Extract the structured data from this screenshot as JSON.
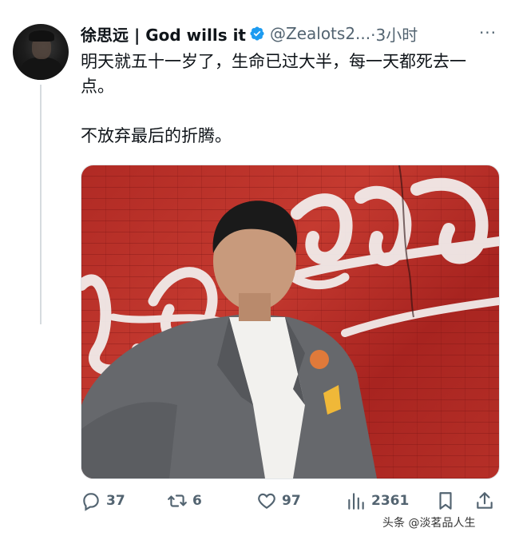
{
  "tweet": {
    "author_name": "徐思远 | God wills it",
    "handle": "@Zealots2...",
    "time": "·3小时",
    "text_line1": "明天就五十一岁了，生命已过大半，每一天都死去一点。",
    "text_line2": "不放弃最后的折腾。"
  },
  "actions": {
    "replies": "37",
    "retweets": "6",
    "likes": "97",
    "views": "2361"
  },
  "icons": {
    "verified": "verified-badge-icon",
    "more": "more-dots-icon",
    "reply": "reply-icon",
    "retweet": "retweet-icon",
    "like": "heart-icon",
    "views": "views-bar-icon",
    "bookmark": "bookmark-icon",
    "share": "share-icon"
  },
  "colors": {
    "verified": "#1d9bf0",
    "muted": "#536471"
  },
  "watermark": "头条 @淡茗品人生"
}
